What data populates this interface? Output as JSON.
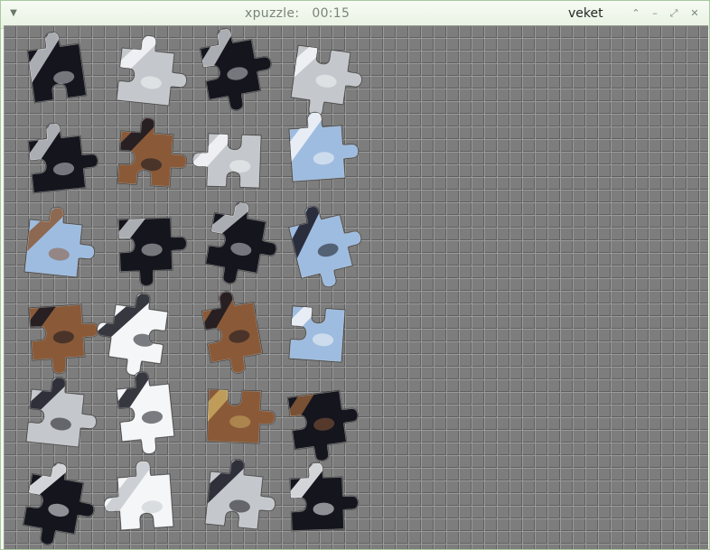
{
  "window": {
    "title": "xpuzzle:",
    "timer": "00:15",
    "owner": "veket",
    "menu_icon": "triangle-down-icon",
    "buttons": [
      "chevron-up-icon",
      "minimize-icon",
      "maximize-icon",
      "close-icon"
    ]
  },
  "colors": {
    "board": "#7d7d7d",
    "grid_light": "#9a9a9a",
    "grid_dark": "#606060",
    "dark": "#15151e",
    "metal": "#c4c8cc",
    "sky": "#9ebce0",
    "white": "#f4f6f8",
    "skin": "#8a5a38",
    "hair": "#c8a860"
  },
  "pieces": [
    {
      "row": 0,
      "col": 0,
      "fill": "dark",
      "accent": "metal",
      "tabs": [
        1,
        0,
        -1,
        0
      ]
    },
    {
      "row": 0,
      "col": 1,
      "fill": "metal",
      "accent": "white",
      "tabs": [
        1,
        1,
        0,
        -1
      ]
    },
    {
      "row": 0,
      "col": 2,
      "fill": "dark",
      "accent": "metal",
      "tabs": [
        1,
        1,
        1,
        -1
      ]
    },
    {
      "row": 0,
      "col": 3,
      "fill": "metal",
      "accent": "white",
      "tabs": [
        -1,
        1,
        1,
        0
      ]
    },
    {
      "row": 1,
      "col": 0,
      "fill": "dark",
      "accent": "metal",
      "tabs": [
        1,
        1,
        0,
        -1
      ]
    },
    {
      "row": 1,
      "col": 1,
      "fill": "skin",
      "accent": "dark",
      "tabs": [
        1,
        1,
        -1,
        -1
      ]
    },
    {
      "row": 1,
      "col": 2,
      "fill": "metal",
      "accent": "white",
      "tabs": [
        -1,
        0,
        -1,
        1
      ]
    },
    {
      "row": 1,
      "col": 3,
      "fill": "sky",
      "accent": "white",
      "tabs": [
        1,
        1,
        0,
        0
      ]
    },
    {
      "row": 2,
      "col": 0,
      "fill": "sky",
      "accent": "skin",
      "tabs": [
        1,
        1,
        0,
        0
      ]
    },
    {
      "row": 2,
      "col": 1,
      "fill": "dark",
      "accent": "metal",
      "tabs": [
        0,
        1,
        1,
        -1
      ]
    },
    {
      "row": 2,
      "col": 2,
      "fill": "dark",
      "accent": "metal",
      "tabs": [
        1,
        1,
        1,
        -1
      ]
    },
    {
      "row": 2,
      "col": 3,
      "fill": "sky",
      "accent": "dark",
      "tabs": [
        1,
        1,
        1,
        0
      ]
    },
    {
      "row": 3,
      "col": 0,
      "fill": "skin",
      "accent": "dark",
      "tabs": [
        0,
        1,
        1,
        -1
      ]
    },
    {
      "row": 3,
      "col": 1,
      "fill": "white",
      "accent": "dark",
      "tabs": [
        1,
        -1,
        1,
        1
      ]
    },
    {
      "row": 3,
      "col": 2,
      "fill": "skin",
      "accent": "dark",
      "tabs": [
        1,
        0,
        1,
        -1
      ]
    },
    {
      "row": 3,
      "col": 3,
      "fill": "sky",
      "accent": "white",
      "tabs": [
        -1,
        0,
        0,
        -1
      ]
    },
    {
      "row": 4,
      "col": 0,
      "fill": "metal",
      "accent": "dark",
      "tabs": [
        1,
        1,
        0,
        -1
      ]
    },
    {
      "row": 4,
      "col": 1,
      "fill": "white",
      "accent": "dark",
      "tabs": [
        1,
        0,
        1,
        -1
      ]
    },
    {
      "row": 4,
      "col": 2,
      "fill": "skin",
      "accent": "hair",
      "tabs": [
        -1,
        1,
        0,
        0
      ]
    },
    {
      "row": 4,
      "col": 3,
      "fill": "dark",
      "accent": "skin",
      "tabs": [
        0,
        1,
        1,
        -1
      ]
    },
    {
      "row": 5,
      "col": 0,
      "fill": "dark",
      "accent": "white",
      "tabs": [
        1,
        1,
        1,
        -1
      ]
    },
    {
      "row": 5,
      "col": 1,
      "fill": "white",
      "accent": "metal",
      "tabs": [
        1,
        0,
        -1,
        1
      ]
    },
    {
      "row": 5,
      "col": 2,
      "fill": "metal",
      "accent": "dark",
      "tabs": [
        1,
        1,
        -1,
        0
      ]
    },
    {
      "row": 5,
      "col": 3,
      "fill": "dark",
      "accent": "white",
      "tabs": [
        1,
        1,
        0,
        -1
      ]
    }
  ]
}
